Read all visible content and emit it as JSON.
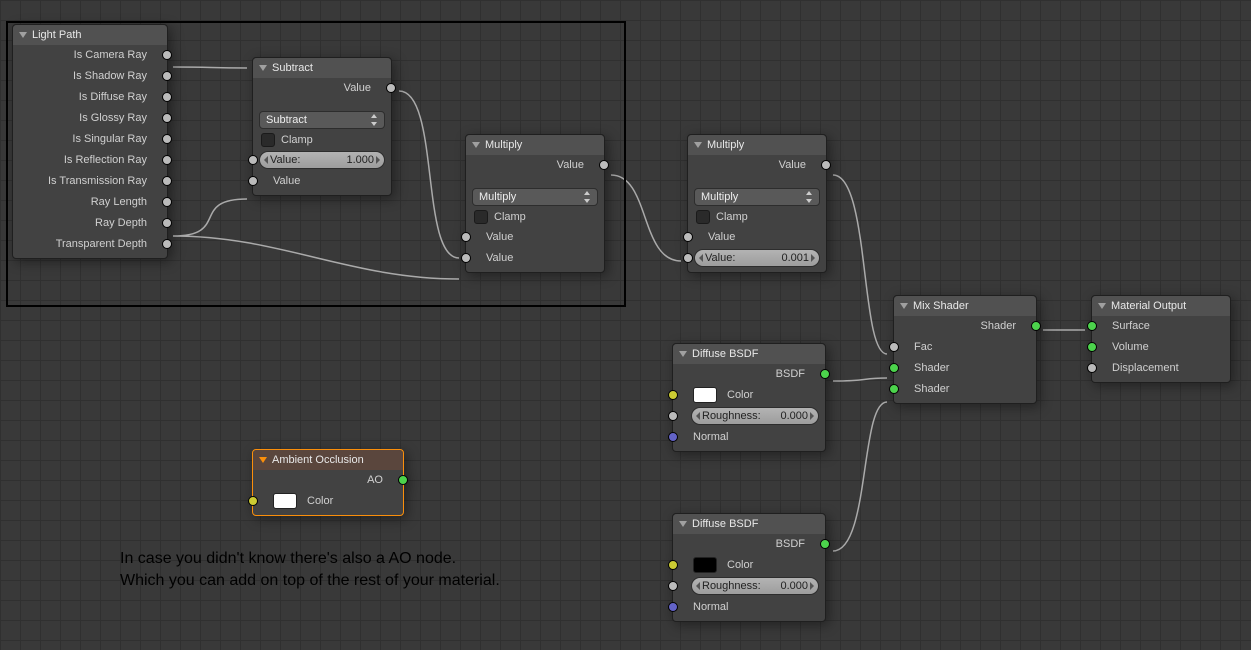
{
  "annotation": {
    "line1": "In case you didn't know there's also a AO node.",
    "line2": "Which you can add on top of the rest of your material."
  },
  "nodes": {
    "light_path": {
      "title": "Light Path",
      "outputs": [
        "Is Camera Ray",
        "Is Shadow Ray",
        "Is Diffuse Ray",
        "Is Glossy Ray",
        "Is Singular Ray",
        "Is Reflection Ray",
        "Is Transmission Ray",
        "Ray Length",
        "Ray Depth",
        "Transparent Depth"
      ]
    },
    "subtract": {
      "title": "Subtract",
      "out": "Value",
      "op": "Subtract",
      "clamp": "Clamp",
      "value_label": "Value:",
      "value": "1.000",
      "in": "Value"
    },
    "multiply1": {
      "title": "Multiply",
      "out": "Value",
      "op": "Multiply",
      "clamp": "Clamp",
      "in1": "Value",
      "in2": "Value"
    },
    "multiply2": {
      "title": "Multiply",
      "out": "Value",
      "op": "Multiply",
      "clamp": "Clamp",
      "in1": "Value",
      "value_label": "Value:",
      "value": "0.001"
    },
    "ao": {
      "title": "Ambient Occlusion",
      "out": "AO",
      "color_lbl": "Color",
      "color": "#ffffff"
    },
    "diffuse1": {
      "title": "Diffuse BSDF",
      "out": "BSDF",
      "color_lbl": "Color",
      "color": "#ffffff",
      "rough_lbl": "Roughness:",
      "rough": "0.000",
      "normal": "Normal"
    },
    "diffuse2": {
      "title": "Diffuse BSDF",
      "out": "BSDF",
      "color_lbl": "Color",
      "color": "#000000",
      "rough_lbl": "Roughness:",
      "rough": "0.000",
      "normal": "Normal"
    },
    "mix": {
      "title": "Mix Shader",
      "out": "Shader",
      "fac": "Fac",
      "in1": "Shader",
      "in2": "Shader"
    },
    "matout": {
      "title": "Material Output",
      "surface": "Surface",
      "volume": "Volume",
      "disp": "Displacement"
    }
  }
}
